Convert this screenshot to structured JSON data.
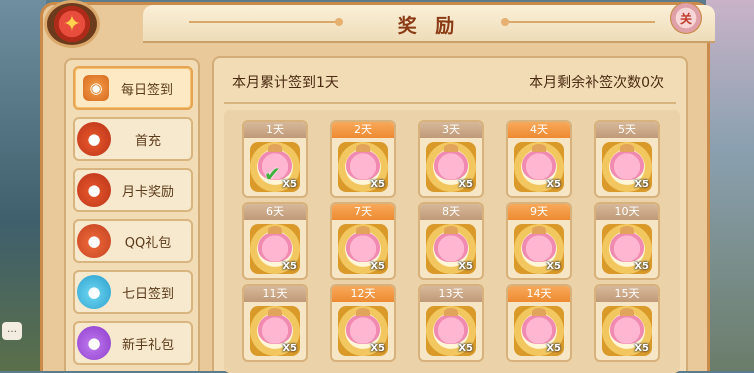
{
  "window": {
    "title": "奖 励",
    "close_label": "关"
  },
  "sidebar": {
    "items": [
      {
        "label": "每日签到",
        "icon": "daily-checkin-icon",
        "active": true
      },
      {
        "label": "首充",
        "icon": "red-bag-icon",
        "active": false
      },
      {
        "label": "月卡奖励",
        "icon": "red-bag-icon",
        "active": false
      },
      {
        "label": "QQ礼包",
        "icon": "red-bag-icon",
        "active": false
      },
      {
        "label": "七日签到",
        "icon": "blue-bag-icon",
        "active": false
      },
      {
        "label": "新手礼包",
        "icon": "purple-bag-icon",
        "active": false
      }
    ]
  },
  "summary": {
    "left": "本月累计签到1天",
    "right": "本月剩余补签次数0次"
  },
  "days": [
    {
      "label": "1天",
      "qty": "X5",
      "claimed": true
    },
    {
      "label": "2天",
      "qty": "X5",
      "claimed": false
    },
    {
      "label": "3天",
      "qty": "X5",
      "claimed": false
    },
    {
      "label": "4天",
      "qty": "X5",
      "claimed": false
    },
    {
      "label": "5天",
      "qty": "X5",
      "claimed": false
    },
    {
      "label": "6天",
      "qty": "X5",
      "claimed": false
    },
    {
      "label": "7天",
      "qty": "X5",
      "claimed": false
    },
    {
      "label": "8天",
      "qty": "X5",
      "claimed": false
    },
    {
      "label": "9天",
      "qty": "X5",
      "claimed": false
    },
    {
      "label": "10天",
      "qty": "X5",
      "claimed": false
    },
    {
      "label": "11天",
      "qty": "X5",
      "claimed": false
    },
    {
      "label": "12天",
      "qty": "X5",
      "claimed": false
    },
    {
      "label": "13天",
      "qty": "X5",
      "claimed": false
    },
    {
      "label": "14天",
      "qty": "X5",
      "claimed": false
    },
    {
      "label": "15天",
      "qty": "X5",
      "claimed": false
    }
  ]
}
